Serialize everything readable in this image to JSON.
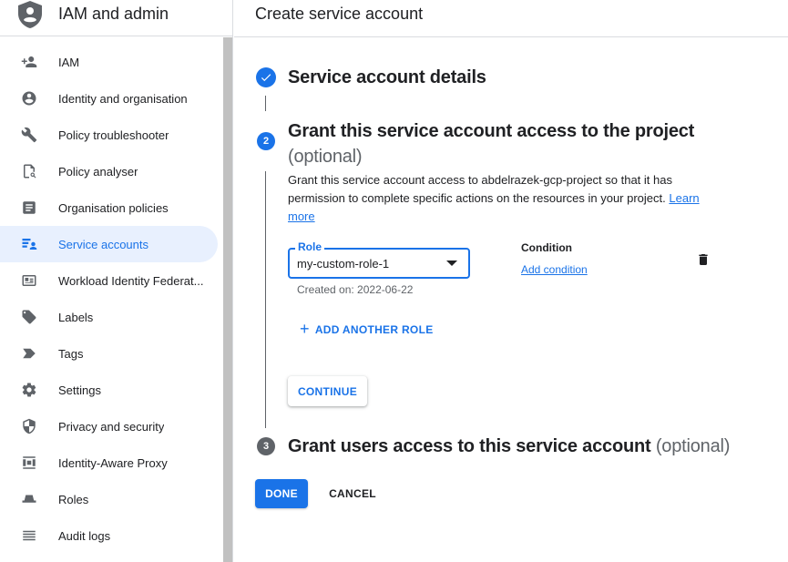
{
  "sidebar": {
    "title": "IAM and admin",
    "items": [
      {
        "label": "IAM",
        "icon": "person-add-icon",
        "active": false
      },
      {
        "label": "Identity and organisation",
        "icon": "account-circle-icon",
        "active": false
      },
      {
        "label": "Policy troubleshooter",
        "icon": "wrench-icon",
        "active": false
      },
      {
        "label": "Policy analyser",
        "icon": "document-search-icon",
        "active": false
      },
      {
        "label": "Organisation policies",
        "icon": "article-icon",
        "active": false
      },
      {
        "label": "Service accounts",
        "icon": "service-account-icon",
        "active": true
      },
      {
        "label": "Workload Identity Federat...",
        "icon": "id-card-icon",
        "active": false
      },
      {
        "label": "Labels",
        "icon": "label-icon",
        "active": false
      },
      {
        "label": "Tags",
        "icon": "tag-chevron-icon",
        "active": false
      },
      {
        "label": "Settings",
        "icon": "gear-icon",
        "active": false
      },
      {
        "label": "Privacy and security",
        "icon": "shield-icon",
        "active": false
      },
      {
        "label": "Identity-Aware Proxy",
        "icon": "proxy-icon",
        "active": false
      },
      {
        "label": "Roles",
        "icon": "hat-icon",
        "active": false
      },
      {
        "label": "Audit logs",
        "icon": "list-lines-icon",
        "active": false
      }
    ]
  },
  "main": {
    "page_title": "Create service account",
    "step1": {
      "title": "Service account details"
    },
    "step2": {
      "number": "2",
      "title": "Grant this service account access to the project",
      "optional": "(optional)",
      "description": "Grant this service account access to abdelrazek-gcp-project so that it has permission to complete specific actions on the resources in your project.",
      "learn_more": "Learn more",
      "role_label": "Role",
      "role_value": "my-custom-role-1",
      "created_on": "Created on: 2022-06-22",
      "condition_label": "Condition",
      "add_condition": "Add condition",
      "add_another_role": "ADD ANOTHER ROLE",
      "continue": "CONTINUE"
    },
    "step3": {
      "number": "3",
      "title": "Grant users access to this service account",
      "optional": "(optional)"
    },
    "done": "DONE",
    "cancel": "CANCEL"
  },
  "colors": {
    "accent": "#1a73e8",
    "active_bg": "#e8f0fe",
    "icon": "#5f6368"
  }
}
